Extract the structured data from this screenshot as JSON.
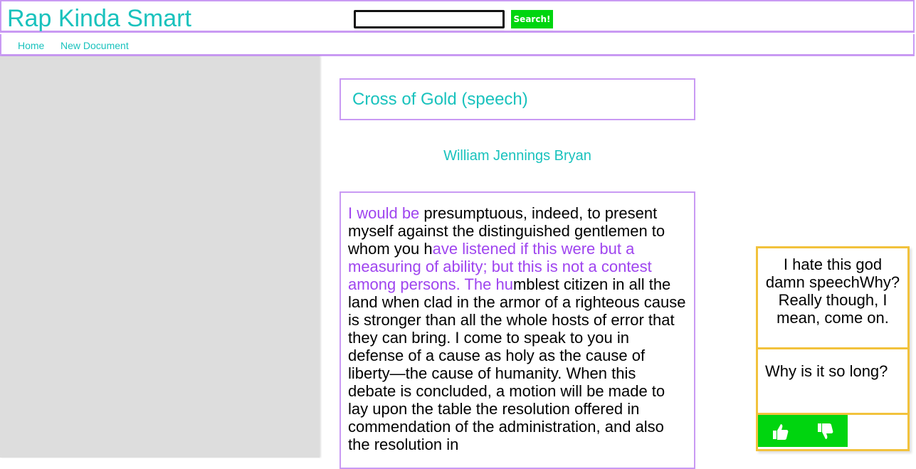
{
  "header": {
    "brand": "Rap Kinda Smart",
    "search": {
      "value": "",
      "placeholder": "",
      "button_label": "Search!"
    }
  },
  "nav": {
    "home": "Home",
    "new_document": "New Document"
  },
  "document": {
    "title": "Cross of Gold (speech)",
    "author": "William Jennings Bryan",
    "text_segments": [
      {
        "text": "I would be",
        "annotated": true
      },
      {
        "text": " presumptuous, indeed, to present myself against the distinguished gentlemen to whom you h",
        "annotated": false
      },
      {
        "text": "ave listened if this were but a measuring of ability; but this is not a contest among persons. The hu",
        "annotated": true
      },
      {
        "text": "mblest citizen in all the land when clad in the armor of a righteous cause is stronger than all the whole hosts of error that they can bring. I come to speak to you in defense of a cause as holy as the cause of liberty—the cause of humanity. When this debate is concluded, a motion will be made to lay upon the table the resolution offered in commendation of the administration, and also the resolution in",
        "annotated": false
      }
    ]
  },
  "annotation": {
    "main_text": "I hate this god damn speechWhy? Really though, I mean, come on.",
    "question_text": "Why is it so long?",
    "upvote_icon": "thumbs-up-icon",
    "downvote_icon": "thumbs-down-icon"
  },
  "colors": {
    "accent_teal": "#19c2bd",
    "accent_purple": "#c99af3",
    "annotation_purple": "#9f45ef",
    "button_green": "#00d50f",
    "annotation_border": "#f2c23c",
    "sidebar_gray": "#dddddd"
  }
}
